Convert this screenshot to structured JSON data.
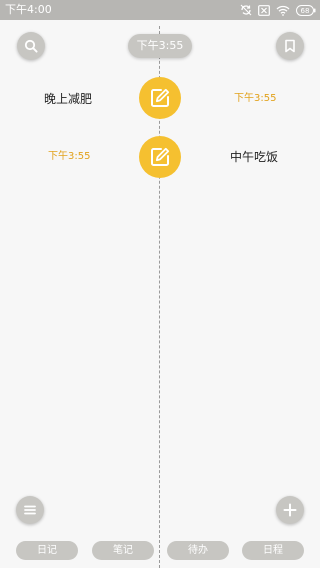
{
  "status_bar": {
    "time": "下午4:00",
    "battery_level": "68"
  },
  "header": {
    "current_time": "下午3:55"
  },
  "entries": [
    {
      "text": "晚上减肥",
      "time": "下午3:55"
    },
    {
      "text": "中午吃饭",
      "time": "下午3:55"
    }
  ],
  "tabs": [
    {
      "label": "日记"
    },
    {
      "label": "笔记"
    },
    {
      "label": "待办"
    },
    {
      "label": "日程"
    }
  ],
  "colors": {
    "accent": "#f5c030",
    "time_text": "#e2a21c",
    "button_gray": "#c7c6c2",
    "status_bar": "#b7b6b3"
  },
  "icons": {
    "top_left": "search-icon",
    "top_right": "bookmark-icon",
    "entry": "edit-note-icon",
    "bottom_left": "menu-icon",
    "bottom_right": "add-icon"
  }
}
